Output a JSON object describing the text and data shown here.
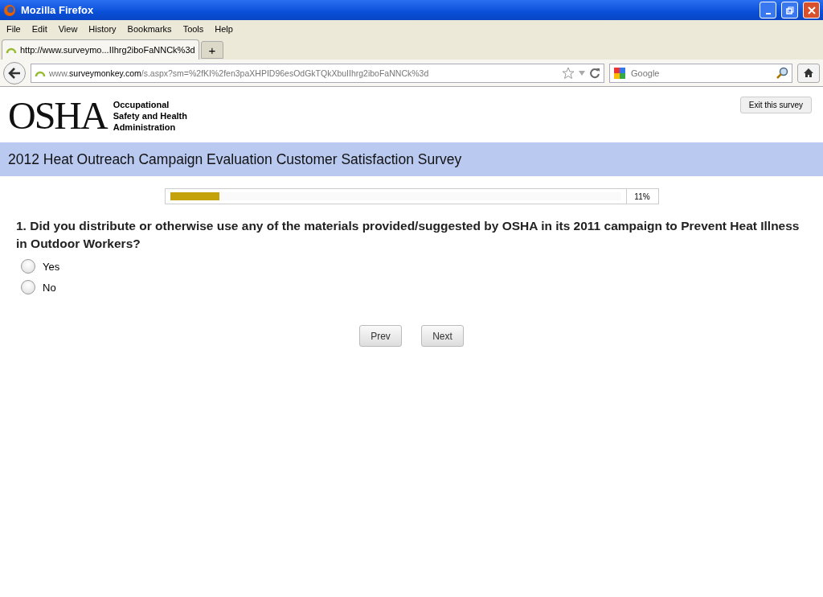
{
  "window": {
    "title": "Mozilla Firefox"
  },
  "menu": [
    "File",
    "Edit",
    "View",
    "History",
    "Bookmarks",
    "Tools",
    "Help"
  ],
  "tabs": [
    {
      "label": "http://www.surveymo...IIhrg2iboFaNNCk%3d",
      "selected": true
    }
  ],
  "new_tab": "+",
  "address_bar": {
    "domain_prefix": "www.",
    "domain": "surveymonkey.com",
    "path": "/s.aspx?sm=%2fKI%2fen3paXHPID96esOdGkTQkXbuIIhrg2iboFaNNCk%3d"
  },
  "search": {
    "placeholder": "Google"
  },
  "header": {
    "logo": "OSHA",
    "agency": [
      "Occupational",
      "Safety and Health",
      "Administration"
    ],
    "exit_button": "Exit this survey"
  },
  "survey_title": "2012 Heat Outreach Campaign Evaluation Customer Satisfaction Survey",
  "progress": {
    "level": 0.11,
    "reading": "11%"
  },
  "question": "1. Did you distribute or otherwise use any of the materials provided/suggested by OSHA in its 2011 campaign to Prevent Heat Illness in Outdoor Workers?",
  "options": [
    {
      "label": "Yes",
      "selected": false
    },
    {
      "label": "No",
      "selected": false
    }
  ],
  "buttons": [
    "Prev",
    "Next"
  ]
}
